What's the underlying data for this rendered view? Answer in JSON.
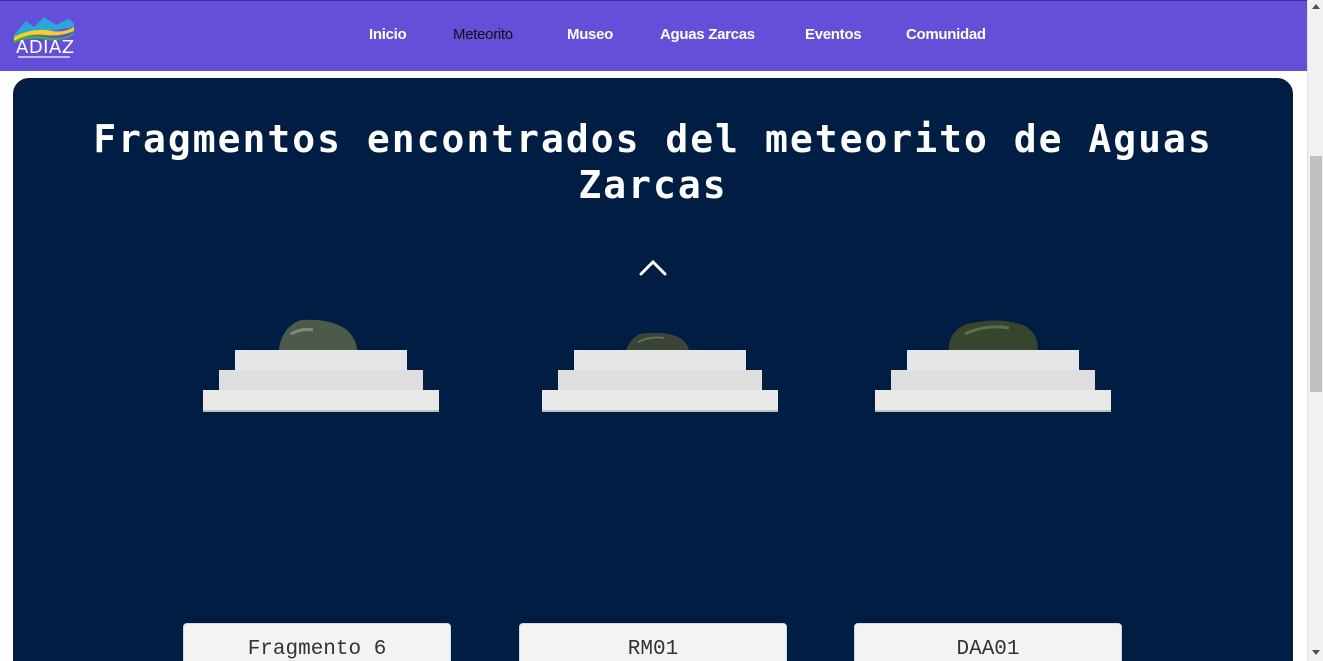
{
  "brand": {
    "name": "ADIAZ",
    "logo_icon": "mountain-wave-logo"
  },
  "nav": {
    "items": [
      {
        "label": "Inicio",
        "active": false
      },
      {
        "label": "Meteorito",
        "active": true
      },
      {
        "label": "Museo",
        "active": false
      },
      {
        "label": "Aguas Zarcas",
        "active": false
      },
      {
        "label": "Eventos",
        "active": false
      },
      {
        "label": "Comunidad",
        "active": false
      }
    ]
  },
  "main": {
    "title": "Fragmentos encontrados del meteorito de Aguas Zarcas",
    "carousel_up_icon": "chevron-up-icon",
    "fragments": [
      {
        "label": "Fragmento 6"
      },
      {
        "label": "RM01"
      },
      {
        "label": "DAA01"
      }
    ]
  },
  "colors": {
    "navbar": "#6450d8",
    "card_background": "#001e44",
    "active_nav_text": "#111111",
    "nav_text": "#ffffff"
  }
}
